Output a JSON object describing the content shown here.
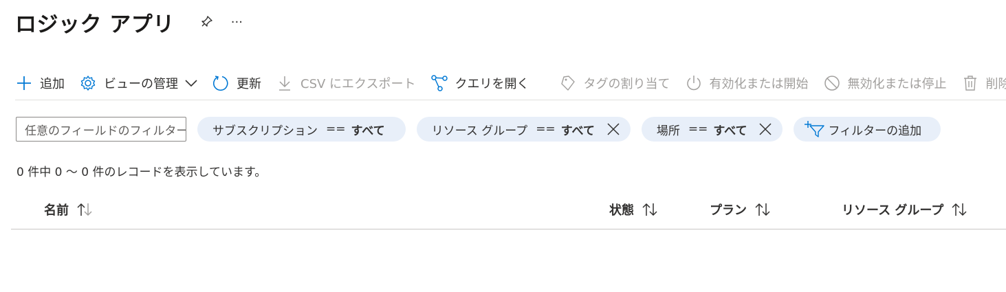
{
  "page": {
    "title": "ロジック アプリ",
    "pin_icon": "pin-icon",
    "more_label": "···"
  },
  "toolbar": {
    "add": "追加",
    "manage_view": "ビューの管理",
    "refresh": "更新",
    "export_csv": "CSV にエクスポート",
    "open_query": "クエリを開く",
    "assign_tags": "タグの割り当て",
    "enable_start": "有効化または開始",
    "disable_stop": "無効化または停止",
    "delete": "削除"
  },
  "filters": {
    "search_placeholder": "任意のフィールドのフィルター...",
    "pills": [
      {
        "name": "サブスクリプション",
        "op": "==",
        "value": "すべて"
      },
      {
        "name": "リソース グループ",
        "op": "==",
        "value": "すべて"
      },
      {
        "name": "場所",
        "op": "==",
        "value": "すべて"
      }
    ],
    "add_filter": "フィルターの追加"
  },
  "records": {
    "summary": "0 件中 0 〜 0 件のレコードを表示しています。"
  },
  "table": {
    "columns": [
      "名前",
      "状態",
      "プラン",
      "リソース グループ"
    ]
  },
  "colors": {
    "accent": "#0078d4",
    "pill_bg": "#e8eff9",
    "disabled_text": "#a19f9d"
  }
}
